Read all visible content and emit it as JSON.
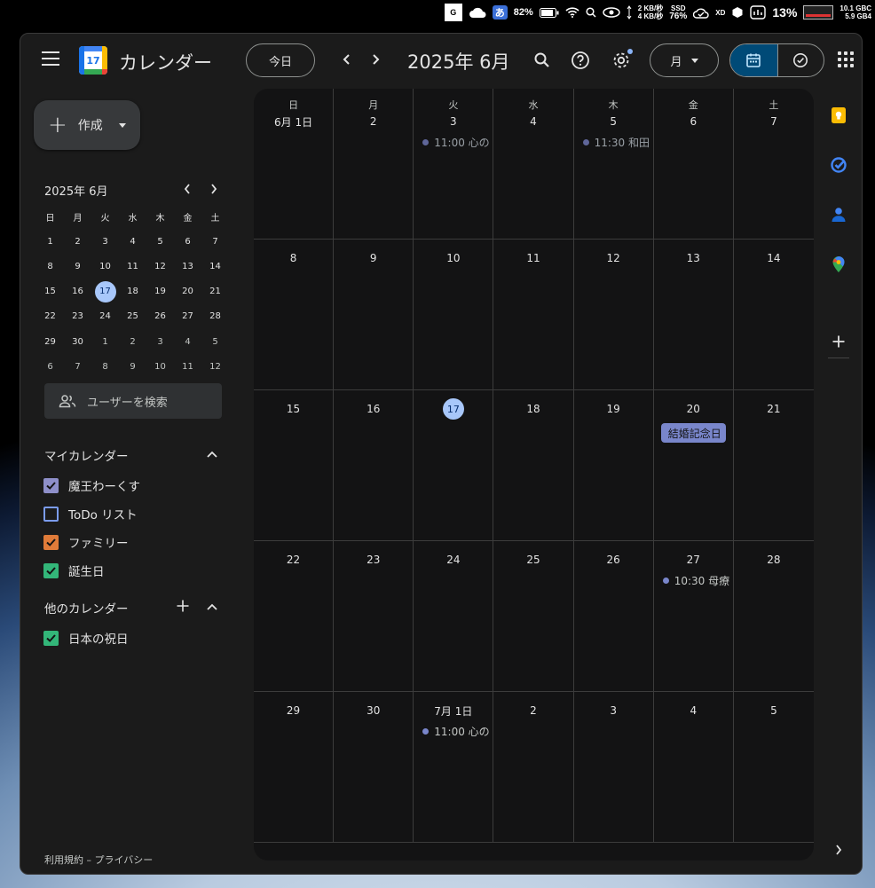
{
  "menubar": {
    "box_char": "G",
    "ime_label": "あ",
    "battery_pct": "82%",
    "net_up": "2 KB/秒",
    "net_down": "4 KB/秒",
    "ssd_label": "SSD",
    "ssd_pct": "76%",
    "xd_label": "XD",
    "cpu_pct": "13%",
    "mem_line1": "10.1 GBC",
    "mem_line2": "5.9 GB4"
  },
  "header": {
    "app_icon_day": "17",
    "app_title": "カレンダー",
    "today_label": "今日",
    "month_title": "2025年 6月",
    "view_label": "月"
  },
  "sidebar": {
    "create_label": "作成",
    "mini": {
      "title": "2025年 6月",
      "dow": [
        "日",
        "月",
        "火",
        "水",
        "木",
        "金",
        "土"
      ],
      "weeks": [
        [
          "1",
          "2",
          "3",
          "4",
          "5",
          "6",
          "7"
        ],
        [
          "8",
          "9",
          "10",
          "11",
          "12",
          "13",
          "14"
        ],
        [
          "15",
          "16",
          "17",
          "18",
          "19",
          "20",
          "21"
        ],
        [
          "22",
          "23",
          "24",
          "25",
          "26",
          "27",
          "28"
        ],
        [
          "29",
          "30",
          "1",
          "2",
          "3",
          "4",
          "5"
        ],
        [
          "6",
          "7",
          "8",
          "9",
          "10",
          "11",
          "12"
        ]
      ]
    },
    "user_search_placeholder": "ユーザーを検索",
    "my_calendars_title": "マイカレンダー",
    "my_calendars": [
      {
        "label": "魔王わーくす",
        "color": "#8e8fc9",
        "checked": true
      },
      {
        "label": "ToDo リスト",
        "color": "#7b9cf0",
        "checked": false
      },
      {
        "label": "ファミリー",
        "color": "#e07b39",
        "checked": true
      },
      {
        "label": "誕生日",
        "color": "#33b679",
        "checked": true
      }
    ],
    "other_calendars_title": "他のカレンダー",
    "other_calendars": [
      {
        "label": "日本の祝日",
        "color": "#33b679",
        "checked": true
      }
    ],
    "footer": "利用規約 – プライバシー"
  },
  "month_view": {
    "dow": [
      "日",
      "月",
      "火",
      "水",
      "木",
      "金",
      "土"
    ],
    "days": [
      {
        "label": "6月 1日"
      },
      {
        "label": "2"
      },
      {
        "label": "3",
        "events": [
          {
            "text": "11:00 心の",
            "dim": true
          }
        ]
      },
      {
        "label": "4"
      },
      {
        "label": "5",
        "events": [
          {
            "text": "11:30 和田",
            "dim": true
          }
        ]
      },
      {
        "label": "6"
      },
      {
        "label": "7"
      },
      {
        "label": "8"
      },
      {
        "label": "9"
      },
      {
        "label": "10"
      },
      {
        "label": "11"
      },
      {
        "label": "12"
      },
      {
        "label": "13"
      },
      {
        "label": "14"
      },
      {
        "label": "15"
      },
      {
        "label": "16"
      },
      {
        "label": "17",
        "today": true
      },
      {
        "label": "18"
      },
      {
        "label": "19"
      },
      {
        "label": "20",
        "allday": "結婚記念日"
      },
      {
        "label": "21"
      },
      {
        "label": "22"
      },
      {
        "label": "23"
      },
      {
        "label": "24"
      },
      {
        "label": "25"
      },
      {
        "label": "26"
      },
      {
        "label": "27",
        "events": [
          {
            "text": "10:30 母療",
            "dim": false
          }
        ]
      },
      {
        "label": "28"
      },
      {
        "label": "29"
      },
      {
        "label": "30"
      },
      {
        "label": "7月 1日",
        "events": [
          {
            "text": "11:00 心の",
            "dim": false
          }
        ]
      },
      {
        "label": "2"
      },
      {
        "label": "3"
      },
      {
        "label": "4"
      },
      {
        "label": "5"
      }
    ]
  },
  "side_panel": {
    "items": [
      "keep-icon",
      "tasks-icon",
      "contacts-icon",
      "maps-icon"
    ]
  }
}
